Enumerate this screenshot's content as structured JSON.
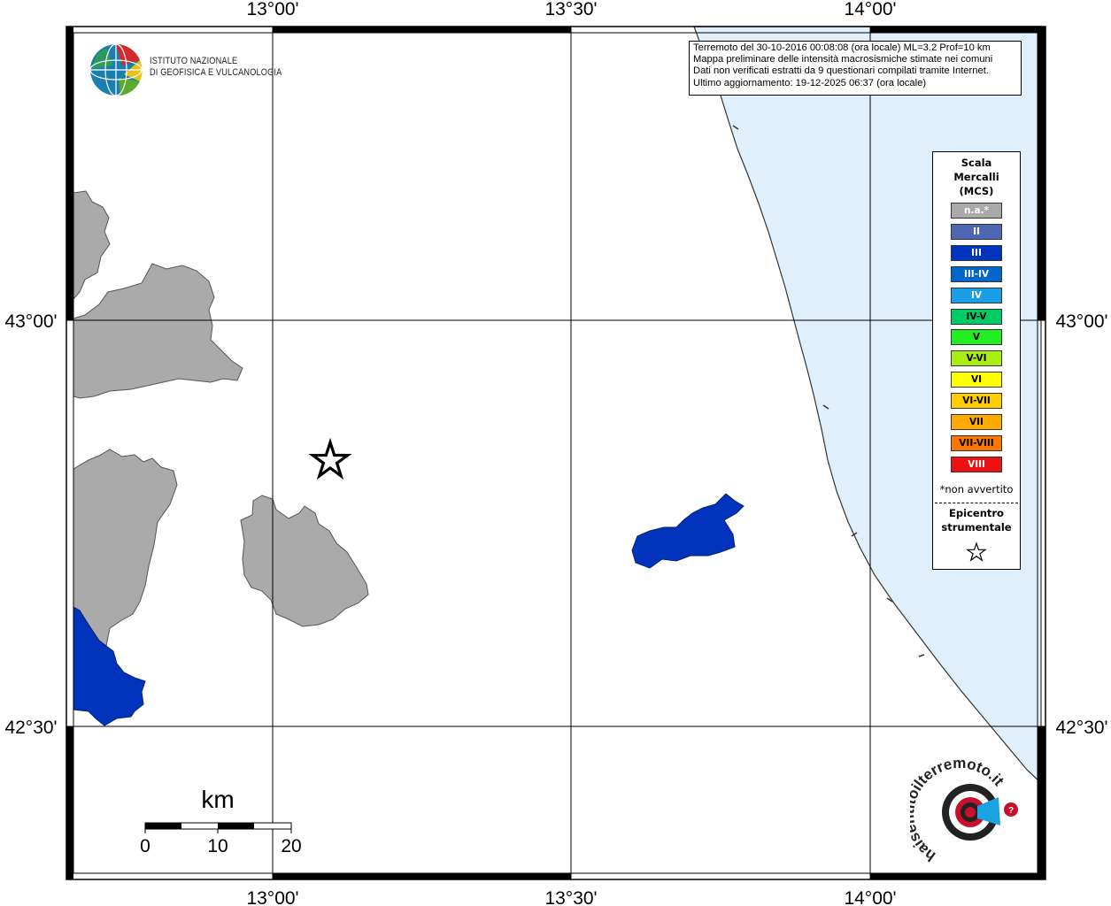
{
  "map": {
    "top_ticks": [
      "13°00'",
      "13°30'",
      "14°00'"
    ],
    "bottom_ticks": [
      "13°00'",
      "13°30'",
      "14°00'"
    ],
    "left_ticks": [
      "43°00'",
      "42°30'"
    ],
    "right_ticks": [
      "43°00'",
      "42°30'"
    ],
    "colors": {
      "sea": "#dff0fc",
      "not_felt": "#aaaaaa",
      "intensity_III": "#0033bb",
      "grid": "#000000"
    }
  },
  "info": {
    "line1": "Terremoto del 30-10-2016 00:08:08 (ora locale) ML=3.2 Prof=10 km",
    "line2": "Mappa preliminare delle intensità macrosismiche stimate nei comuni",
    "line3": "Dati non verificati estratti da 9 questionari compilati tramite Internet.",
    "line4": "Ultimo aggiornamento: 19-12-2025 06:37 (ora locale)"
  },
  "logo_ingv": {
    "line1": "Istituto Nazionale",
    "line2": "di Geofisica e Vulcanologia"
  },
  "legend": {
    "title1": "Scala",
    "title2": "Mercalli",
    "title3": "(MCS)",
    "items": [
      {
        "label": "n.a.*",
        "color": "#aaaaaa",
        "text_color": "#ffffff"
      },
      {
        "label": "II",
        "color": "#4d67b3",
        "text_color": "#ffffff"
      },
      {
        "label": "III",
        "color": "#0033bb",
        "text_color": "#ffffff"
      },
      {
        "label": "III-IV",
        "color": "#0066cc",
        "text_color": "#ffffff"
      },
      {
        "label": "IV",
        "color": "#1a9ee6",
        "text_color": "#ffffff"
      },
      {
        "label": "IV-V",
        "color": "#00cc66",
        "text_color": "#000000"
      },
      {
        "label": "V",
        "color": "#22ee22",
        "text_color": "#000000"
      },
      {
        "label": "V-VI",
        "color": "#aaee11",
        "text_color": "#000000"
      },
      {
        "label": "VI",
        "color": "#ffff00",
        "text_color": "#000000"
      },
      {
        "label": "VI-VII",
        "color": "#ffcc00",
        "text_color": "#000000"
      },
      {
        "label": "VII",
        "color": "#ffaa00",
        "text_color": "#000000"
      },
      {
        "label": "VII-VIII",
        "color": "#ff7700",
        "text_color": "#000000"
      },
      {
        "label": "VIII",
        "color": "#ee1111",
        "text_color": "#ffffff"
      }
    ],
    "note": "*non avvertito",
    "epicentre1": "Epicentro",
    "epicentre2": "strumentale"
  },
  "scalebar": {
    "unit": "km",
    "labels": [
      "0",
      "10",
      "20"
    ]
  },
  "logo_hsit": {
    "text": "haisentitoilterremoto.it"
  }
}
